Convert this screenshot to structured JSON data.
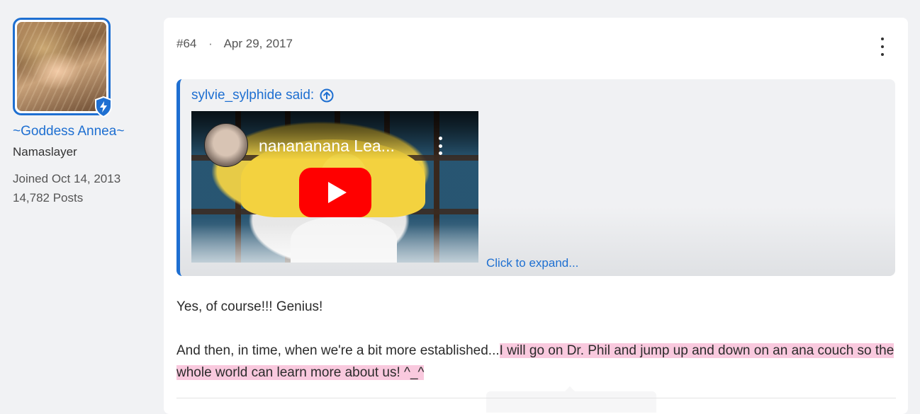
{
  "user": {
    "name": "~Goddess Annea~",
    "title": "Namaslayer",
    "joined": "Joined Oct 14, 2013",
    "posts": "14,782 Posts",
    "badge_icon": "shield-bolt-icon"
  },
  "post": {
    "number": "#64",
    "separator": "·",
    "date": "Apr 29, 2017",
    "menu_icon": "more-vertical-icon",
    "quote": {
      "author": "sylvie_sylphide said:",
      "up_icon": "arrow-up-circle-icon",
      "video_title": "nanananana Lea...",
      "expand_label": "Click to expand..."
    },
    "body": {
      "line1": "Yes, of course!!! Genius!",
      "line2_plain": "And then, in time, when we're a bit more established...",
      "line2_highlight": "I will go on Dr. Phil and jump up and down on an ana couch so the whole world can learn more about us! ^_^"
    }
  },
  "colors": {
    "accent": "#1e6fd1",
    "highlight": "#f9c9de",
    "page_bg": "#f1f2f4",
    "youtube_red": "#ff0000"
  }
}
